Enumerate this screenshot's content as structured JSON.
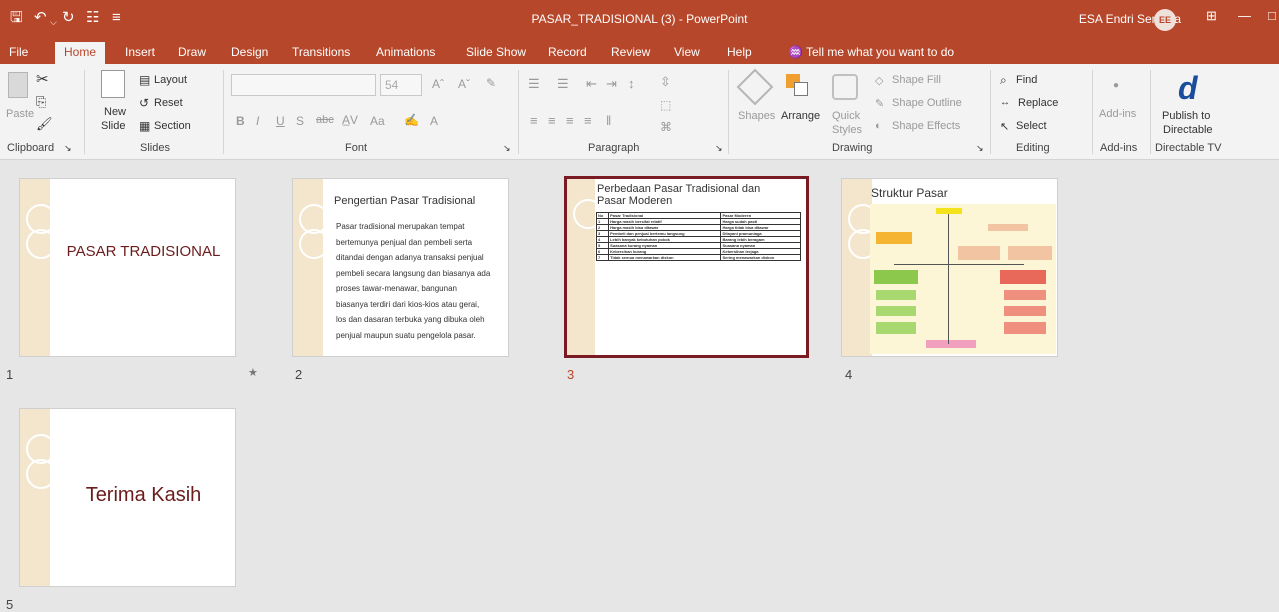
{
  "title_bar": {
    "quick_access": [
      "save-icon",
      "undo-icon",
      "redo-icon",
      "presenter-icon",
      "customize-icon"
    ],
    "document_title": "PASAR_TRADISIONAL (3)  -  PowerPoint",
    "user_name": "ESA Endri Sentosa",
    "user_initials": "EE"
  },
  "tabs": [
    "File",
    "Home",
    "Insert",
    "Draw",
    "Design",
    "Transitions",
    "Animations",
    "Slide Show",
    "Record",
    "Review",
    "View",
    "Help"
  ],
  "active_tab": "Home",
  "tell_me": "Tell me what you want to do",
  "ribbon": {
    "clipboard": {
      "label": "Clipboard",
      "paste": "Paste"
    },
    "slides": {
      "label": "Slides",
      "new_slide": "New",
      "new_slide2": "Slide",
      "layout": "Layout",
      "reset": "Reset",
      "section": "Section"
    },
    "font": {
      "label": "Font",
      "size": "54",
      "bold": "B",
      "italic": "I",
      "underline": "U",
      "shadow": "S",
      "strike": "abc",
      "aa": "Aa"
    },
    "paragraph": {
      "label": "Paragraph"
    },
    "drawing": {
      "label": "Drawing",
      "shapes": "Shapes",
      "arrange": "Arrange",
      "quick_styles": "Quick",
      "quick_styles2": "Styles",
      "shape_fill": "Shape Fill",
      "shape_outline": "Shape Outline",
      "shape_effects": "Shape Effects"
    },
    "editing": {
      "label": "Editing",
      "find": "Find",
      "replace": "Replace",
      "select": "Select"
    },
    "addins": {
      "label": "Add-ins",
      "addins_btn": "Add-ins"
    },
    "directable": {
      "label": "Directable TV",
      "publish": "Publish to",
      "publish2": "Directable"
    }
  },
  "slides": [
    {
      "number": "1",
      "title": "PASAR TRADISIONAL",
      "star": "★"
    },
    {
      "number": "2",
      "title": "Pengertian Pasar Tradisional",
      "body": [
        "Pasar tradisional merupakan tempat",
        "bertemunya penjual dan pembeli serta",
        "ditandai dengan adanya transaksi penjual",
        "pembeli secara langsung dan biasanya ada",
        "proses tawar-menawar, bangunan",
        "biasanya terdiri dari kios-kios atau gerai,",
        "los dan dasaran terbuka yang dibuka oleh",
        "penjual maupun suatu pengelola pasar."
      ]
    },
    {
      "number": "3",
      "title": "Perbedaan Pasar Tradisional dan",
      "title2": "Pasar Moderen",
      "table_header": [
        "No",
        "Pasar Tradisional",
        "Pasar Moderen"
      ],
      "table_rows": [
        [
          "1",
          "Harga masih bersifat relatif",
          "Harga sudah pasti"
        ],
        [
          "2",
          "Harga masih bisa ditawar",
          "Harga tidak bisa ditawar"
        ],
        [
          "3",
          "Pembeli dan penjual bertemu langsung",
          "Dilayani pramuniaga"
        ],
        [
          "4",
          "Lebih banyak kebutuhan pokok",
          "Barang lebih beragam"
        ],
        [
          "5",
          "Suasana kurang nyaman",
          "Suasana nyaman"
        ],
        [
          "6",
          "Kebersihan kurang",
          "Kebersihan terjaga"
        ],
        [
          "7",
          "Tidak semua menawarkan diskon",
          "Sering menawarkan diskon"
        ]
      ]
    },
    {
      "number": "4",
      "title": "Struktur Pasar"
    },
    {
      "number": "5",
      "title": "Terima Kasih"
    }
  ],
  "colors": {
    "accent": "#b7472a",
    "selected_border": "#7a1a22",
    "deco": "#f3e6cd"
  }
}
